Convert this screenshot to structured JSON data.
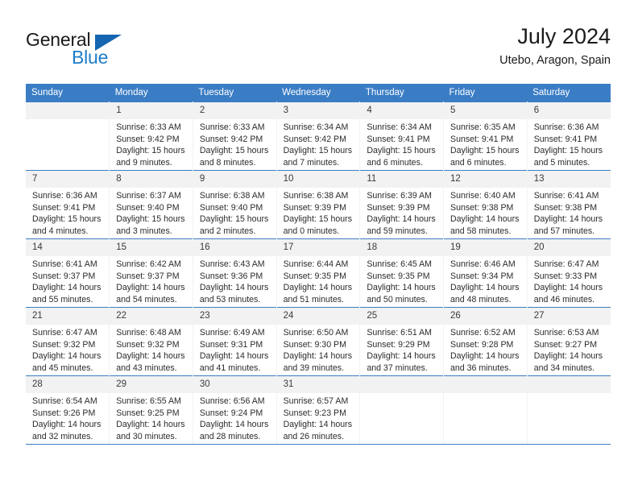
{
  "brand": {
    "name_top": "General",
    "name_bottom": "Blue",
    "triangle_color": "#1565b0",
    "blue_color": "#1d7cc9"
  },
  "header": {
    "title": "July 2024",
    "location": "Utebo, Aragon, Spain"
  },
  "theme": {
    "header_bg": "#3b7dc4",
    "daynum_bg": "#f2f2f2",
    "grid_line": "#3b7dc4"
  },
  "weekdays": [
    "Sunday",
    "Monday",
    "Tuesday",
    "Wednesday",
    "Thursday",
    "Friday",
    "Saturday"
  ],
  "weeks": [
    [
      {
        "day": "",
        "sunrise": "",
        "sunset": "",
        "daylight_line1": "",
        "daylight_line2": ""
      },
      {
        "day": "1",
        "sunrise": "Sunrise: 6:33 AM",
        "sunset": "Sunset: 9:42 PM",
        "daylight_line1": "Daylight: 15 hours",
        "daylight_line2": "and 9 minutes."
      },
      {
        "day": "2",
        "sunrise": "Sunrise: 6:33 AM",
        "sunset": "Sunset: 9:42 PM",
        "daylight_line1": "Daylight: 15 hours",
        "daylight_line2": "and 8 minutes."
      },
      {
        "day": "3",
        "sunrise": "Sunrise: 6:34 AM",
        "sunset": "Sunset: 9:42 PM",
        "daylight_line1": "Daylight: 15 hours",
        "daylight_line2": "and 7 minutes."
      },
      {
        "day": "4",
        "sunrise": "Sunrise: 6:34 AM",
        "sunset": "Sunset: 9:41 PM",
        "daylight_line1": "Daylight: 15 hours",
        "daylight_line2": "and 6 minutes."
      },
      {
        "day": "5",
        "sunrise": "Sunrise: 6:35 AM",
        "sunset": "Sunset: 9:41 PM",
        "daylight_line1": "Daylight: 15 hours",
        "daylight_line2": "and 6 minutes."
      },
      {
        "day": "6",
        "sunrise": "Sunrise: 6:36 AM",
        "sunset": "Sunset: 9:41 PM",
        "daylight_line1": "Daylight: 15 hours",
        "daylight_line2": "and 5 minutes."
      }
    ],
    [
      {
        "day": "7",
        "sunrise": "Sunrise: 6:36 AM",
        "sunset": "Sunset: 9:41 PM",
        "daylight_line1": "Daylight: 15 hours",
        "daylight_line2": "and 4 minutes."
      },
      {
        "day": "8",
        "sunrise": "Sunrise: 6:37 AM",
        "sunset": "Sunset: 9:40 PM",
        "daylight_line1": "Daylight: 15 hours",
        "daylight_line2": "and 3 minutes."
      },
      {
        "day": "9",
        "sunrise": "Sunrise: 6:38 AM",
        "sunset": "Sunset: 9:40 PM",
        "daylight_line1": "Daylight: 15 hours",
        "daylight_line2": "and 2 minutes."
      },
      {
        "day": "10",
        "sunrise": "Sunrise: 6:38 AM",
        "sunset": "Sunset: 9:39 PM",
        "daylight_line1": "Daylight: 15 hours",
        "daylight_line2": "and 0 minutes."
      },
      {
        "day": "11",
        "sunrise": "Sunrise: 6:39 AM",
        "sunset": "Sunset: 9:39 PM",
        "daylight_line1": "Daylight: 14 hours",
        "daylight_line2": "and 59 minutes."
      },
      {
        "day": "12",
        "sunrise": "Sunrise: 6:40 AM",
        "sunset": "Sunset: 9:38 PM",
        "daylight_line1": "Daylight: 14 hours",
        "daylight_line2": "and 58 minutes."
      },
      {
        "day": "13",
        "sunrise": "Sunrise: 6:41 AM",
        "sunset": "Sunset: 9:38 PM",
        "daylight_line1": "Daylight: 14 hours",
        "daylight_line2": "and 57 minutes."
      }
    ],
    [
      {
        "day": "14",
        "sunrise": "Sunrise: 6:41 AM",
        "sunset": "Sunset: 9:37 PM",
        "daylight_line1": "Daylight: 14 hours",
        "daylight_line2": "and 55 minutes."
      },
      {
        "day": "15",
        "sunrise": "Sunrise: 6:42 AM",
        "sunset": "Sunset: 9:37 PM",
        "daylight_line1": "Daylight: 14 hours",
        "daylight_line2": "and 54 minutes."
      },
      {
        "day": "16",
        "sunrise": "Sunrise: 6:43 AM",
        "sunset": "Sunset: 9:36 PM",
        "daylight_line1": "Daylight: 14 hours",
        "daylight_line2": "and 53 minutes."
      },
      {
        "day": "17",
        "sunrise": "Sunrise: 6:44 AM",
        "sunset": "Sunset: 9:35 PM",
        "daylight_line1": "Daylight: 14 hours",
        "daylight_line2": "and 51 minutes."
      },
      {
        "day": "18",
        "sunrise": "Sunrise: 6:45 AM",
        "sunset": "Sunset: 9:35 PM",
        "daylight_line1": "Daylight: 14 hours",
        "daylight_line2": "and 50 minutes."
      },
      {
        "day": "19",
        "sunrise": "Sunrise: 6:46 AM",
        "sunset": "Sunset: 9:34 PM",
        "daylight_line1": "Daylight: 14 hours",
        "daylight_line2": "and 48 minutes."
      },
      {
        "day": "20",
        "sunrise": "Sunrise: 6:47 AM",
        "sunset": "Sunset: 9:33 PM",
        "daylight_line1": "Daylight: 14 hours",
        "daylight_line2": "and 46 minutes."
      }
    ],
    [
      {
        "day": "21",
        "sunrise": "Sunrise: 6:47 AM",
        "sunset": "Sunset: 9:32 PM",
        "daylight_line1": "Daylight: 14 hours",
        "daylight_line2": "and 45 minutes."
      },
      {
        "day": "22",
        "sunrise": "Sunrise: 6:48 AM",
        "sunset": "Sunset: 9:32 PM",
        "daylight_line1": "Daylight: 14 hours",
        "daylight_line2": "and 43 minutes."
      },
      {
        "day": "23",
        "sunrise": "Sunrise: 6:49 AM",
        "sunset": "Sunset: 9:31 PM",
        "daylight_line1": "Daylight: 14 hours",
        "daylight_line2": "and 41 minutes."
      },
      {
        "day": "24",
        "sunrise": "Sunrise: 6:50 AM",
        "sunset": "Sunset: 9:30 PM",
        "daylight_line1": "Daylight: 14 hours",
        "daylight_line2": "and 39 minutes."
      },
      {
        "day": "25",
        "sunrise": "Sunrise: 6:51 AM",
        "sunset": "Sunset: 9:29 PM",
        "daylight_line1": "Daylight: 14 hours",
        "daylight_line2": "and 37 minutes."
      },
      {
        "day": "26",
        "sunrise": "Sunrise: 6:52 AM",
        "sunset": "Sunset: 9:28 PM",
        "daylight_line1": "Daylight: 14 hours",
        "daylight_line2": "and 36 minutes."
      },
      {
        "day": "27",
        "sunrise": "Sunrise: 6:53 AM",
        "sunset": "Sunset: 9:27 PM",
        "daylight_line1": "Daylight: 14 hours",
        "daylight_line2": "and 34 minutes."
      }
    ],
    [
      {
        "day": "28",
        "sunrise": "Sunrise: 6:54 AM",
        "sunset": "Sunset: 9:26 PM",
        "daylight_line1": "Daylight: 14 hours",
        "daylight_line2": "and 32 minutes."
      },
      {
        "day": "29",
        "sunrise": "Sunrise: 6:55 AM",
        "sunset": "Sunset: 9:25 PM",
        "daylight_line1": "Daylight: 14 hours",
        "daylight_line2": "and 30 minutes."
      },
      {
        "day": "30",
        "sunrise": "Sunrise: 6:56 AM",
        "sunset": "Sunset: 9:24 PM",
        "daylight_line1": "Daylight: 14 hours",
        "daylight_line2": "and 28 minutes."
      },
      {
        "day": "31",
        "sunrise": "Sunrise: 6:57 AM",
        "sunset": "Sunset: 9:23 PM",
        "daylight_line1": "Daylight: 14 hours",
        "daylight_line2": "and 26 minutes."
      },
      {
        "day": "",
        "sunrise": "",
        "sunset": "",
        "daylight_line1": "",
        "daylight_line2": ""
      },
      {
        "day": "",
        "sunrise": "",
        "sunset": "",
        "daylight_line1": "",
        "daylight_line2": ""
      },
      {
        "day": "",
        "sunrise": "",
        "sunset": "",
        "daylight_line1": "",
        "daylight_line2": ""
      }
    ]
  ]
}
